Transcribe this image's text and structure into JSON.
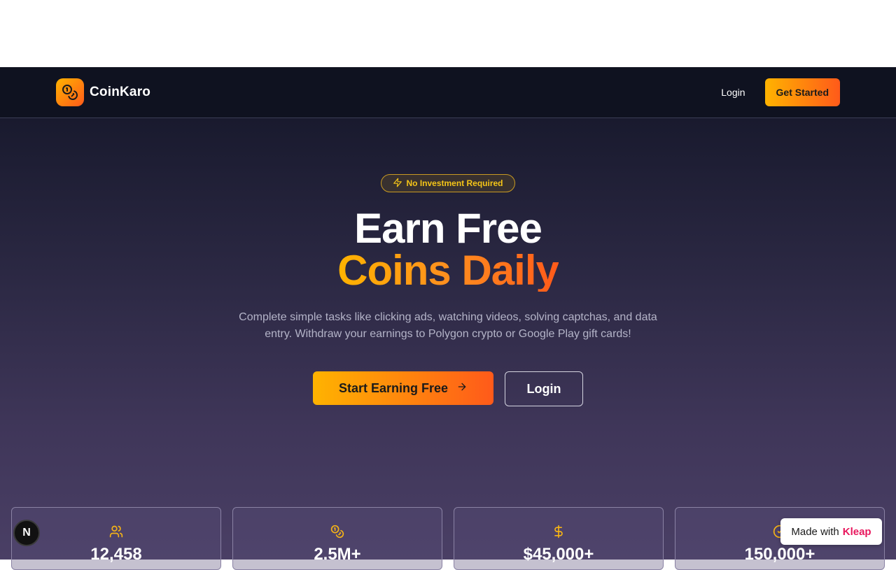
{
  "navbar": {
    "brand_name": "CoinKaro",
    "brand_icon": "coins-icon",
    "login_label": "Login",
    "get_started_label": "Get Started"
  },
  "hero": {
    "badge_icon": "lightning-icon",
    "badge_text": "No Investment Required",
    "title_line1": "Earn Free",
    "title_line2": "Coins Daily",
    "subtitle": "Complete simple tasks like clicking ads, watching videos, solving captchas, and data entry. Withdraw your earnings to Polygon crypto or Google Play gift cards!",
    "primary_cta": "Start Earning Free",
    "primary_cta_icon": "arrow-right-icon",
    "secondary_cta": "Login"
  },
  "stats": [
    {
      "icon": "users-icon",
      "value": "12,458"
    },
    {
      "icon": "coins-icon",
      "value": "2.5M+"
    },
    {
      "icon": "dollar-icon",
      "value": "$45,000+"
    },
    {
      "icon": "check-circle-icon",
      "value": "150,000+"
    }
  ],
  "overlays": {
    "next_badge": "N",
    "made_with_prefix": "Made with",
    "made_with_brand": "Kleap"
  },
  "colors": {
    "accent_start": "#ffb300",
    "accent_end": "#ff5a1a",
    "navbar_bg": "#0f1220",
    "badge_text": "#f5c518",
    "kleap_brand": "#e8175d"
  }
}
